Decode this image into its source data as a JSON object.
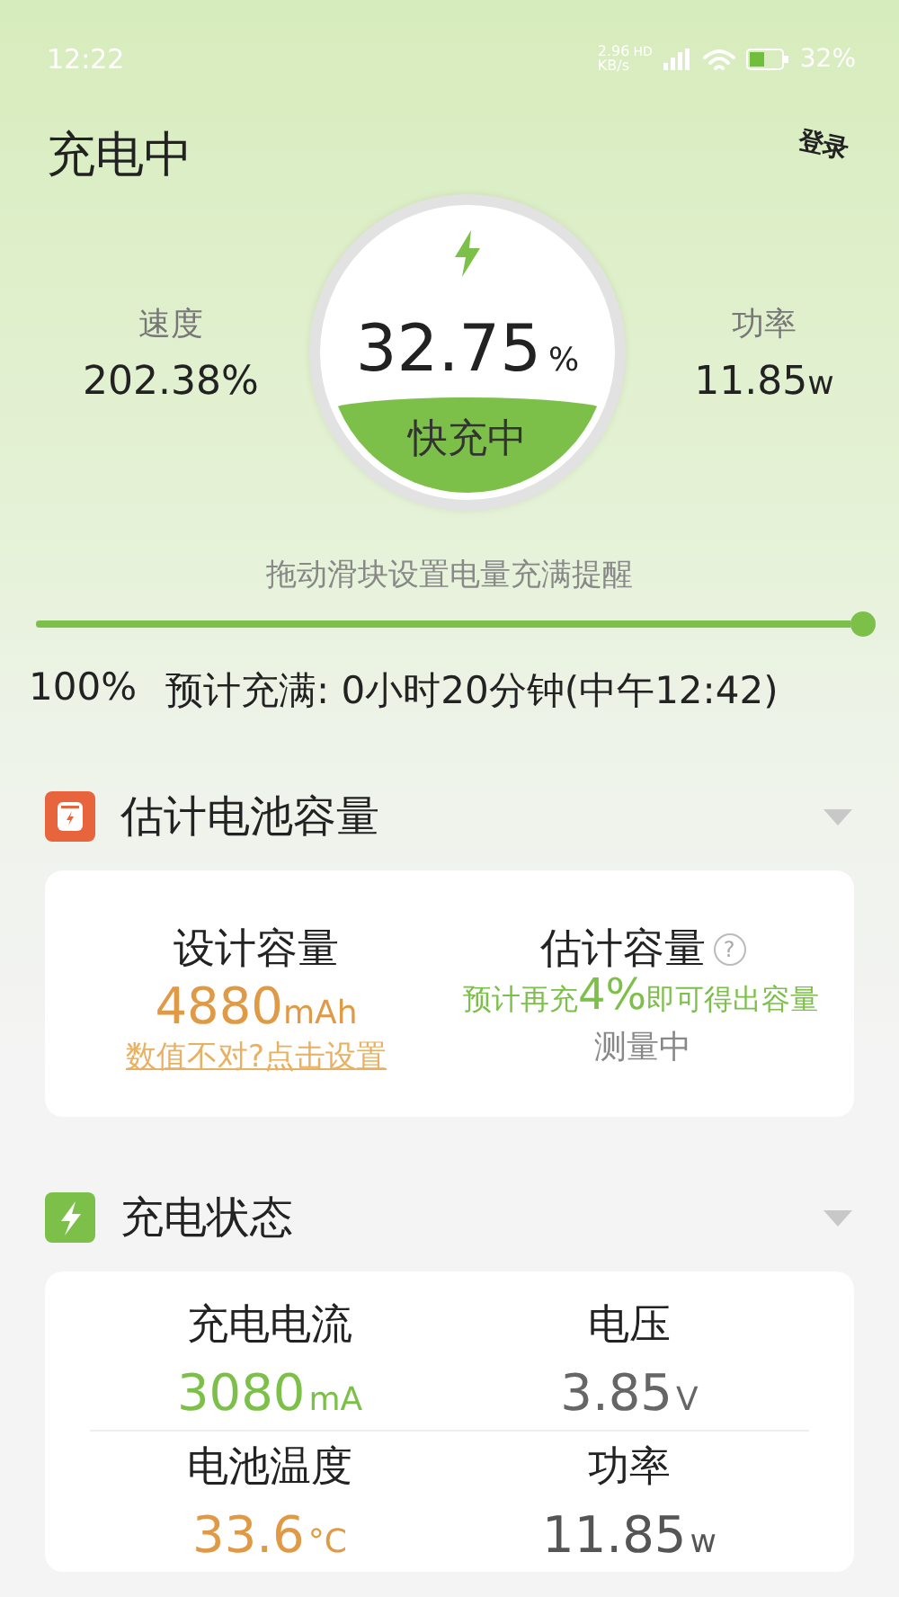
{
  "status_bar": {
    "time": "12:22",
    "net_speed": "2.96",
    "net_unit": "KB/s",
    "network_badge": "HD",
    "battery_percent": "32%"
  },
  "header": {
    "title": "充电中",
    "login": "登录"
  },
  "gauge": {
    "percent": "32.75",
    "percent_unit": "%",
    "status": "快充中"
  },
  "stats": [
    {
      "label": "速度",
      "value": "202.38%"
    },
    {
      "label": "功率",
      "value": "11.85",
      "unit": "w"
    }
  ],
  "reminder": {
    "hint": "拖动滑块设置电量充满提醒",
    "level": 1,
    "percent": "100%",
    "estimate": "预计充满: 0小时20分钟(中午12:42)"
  },
  "capacity_section": {
    "title": "估计电池容量",
    "color": "#e8643c",
    "design_label": "设计容量",
    "design_value": "4880",
    "design_unit": "mAh",
    "design_link": "数值不对?点击设置",
    "estimate_label": "估计容量",
    "estimate_help": "?",
    "estimate_note": "预计再充**4%**即可得出容量",
    "estimate_status": "测量中"
  },
  "charging_section": {
    "title": "充电状态",
    "color": "#7cc04a",
    "items": [
      {
        "label": "充电电流",
        "value": "3080",
        "unit": "mA",
        "color": "#7cc04a"
      },
      {
        "label": "电压",
        "value": "3.85",
        "unit": "V",
        "color": "#666666"
      },
      {
        "label": "电池温度",
        "value": "33.6",
        "unit": "°C",
        "color": "#e09a45"
      },
      {
        "label": "功率",
        "value": "11.85",
        "unit": "w",
        "color": "#555555"
      }
    ]
  }
}
